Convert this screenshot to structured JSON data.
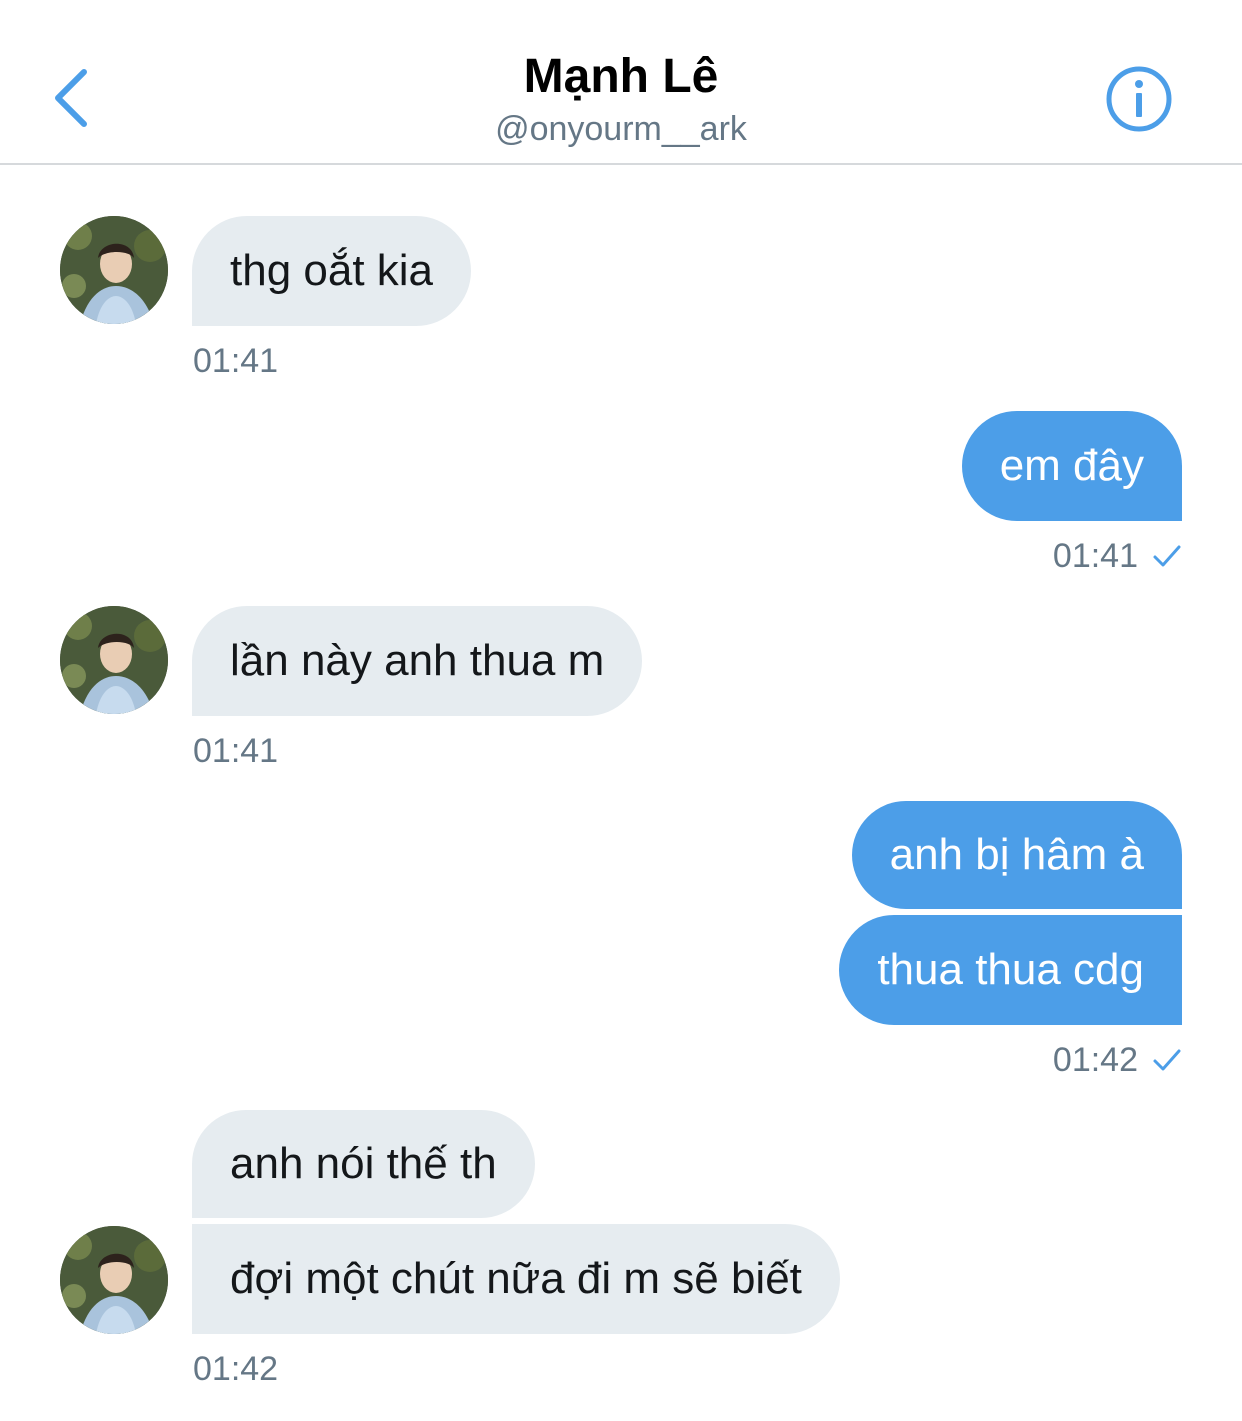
{
  "header": {
    "title": "Mạnh Lê",
    "handle": "@onyourm__ark",
    "back_icon": "chevron-left-icon",
    "info_icon": "info-icon"
  },
  "colors": {
    "accent": "#4c9ee8",
    "incoming_bubble": "#e6ecf0",
    "timestamp": "#657786",
    "divider": "#d6d9dc"
  },
  "messages": [
    {
      "direction": "incoming",
      "text": "thg oắt kia",
      "time": "01:41"
    },
    {
      "direction": "outgoing",
      "text": "em đây",
      "time": "01:41",
      "status_icon": "check-icon"
    },
    {
      "direction": "incoming",
      "text": "lần này anh thua m",
      "time": "01:41"
    },
    {
      "direction": "outgoing",
      "text": "anh bị hâm à"
    },
    {
      "direction": "outgoing",
      "text": "thua thua cdg",
      "time": "01:42",
      "status_icon": "check-icon"
    },
    {
      "direction": "incoming",
      "text": "anh nói thế th"
    },
    {
      "direction": "incoming",
      "text": "đợi một chút nữa đi m sẽ biết",
      "time": "01:42"
    }
  ]
}
